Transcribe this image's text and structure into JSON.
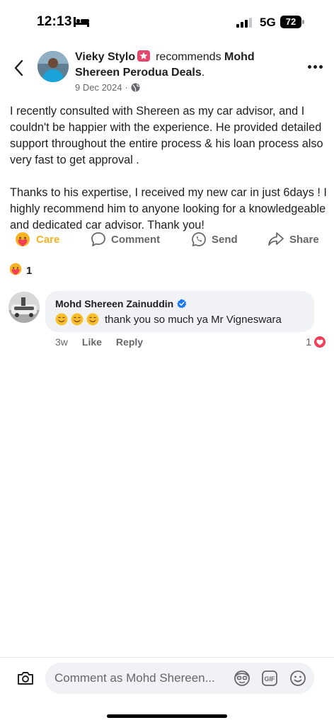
{
  "status_bar": {
    "time": "12:13",
    "network": "5G",
    "battery": "72"
  },
  "header": {
    "author_name": "Vieky Stylo",
    "recommends_label": "recommends",
    "page_name": "Mohd Shereen Perodua Deals",
    "page_suffix": ".",
    "date": "9 Dec 2024",
    "privacy": "public"
  },
  "post": {
    "paragraph_1": "I recently consulted with Shereen as my car advisor, and I couldn't be happier with the experience. He provided detailed support throughout the entire process & his loan process also very fast to get approval .",
    "paragraph_2": "Thanks to his expertise, I received my new car in just 6days ! I highly recommend him to anyone looking for a knowledgeable and dedicated car advisor. Thank you!"
  },
  "actions": {
    "care": "Care",
    "comment": "Comment",
    "send": "Send",
    "share": "Share"
  },
  "reactions": {
    "count": "1"
  },
  "comment": {
    "author": "Mohd Shereen Zainuddin",
    "text": "thank you so much ya Mr Vigneswara",
    "time": "3w",
    "like_label": "Like",
    "reply_label": "Reply",
    "like_count": "1"
  },
  "composer": {
    "placeholder": "Comment as Mohd Shereen..."
  },
  "colors": {
    "accent_care": "#f7b125",
    "verified": "#1877f2",
    "heart": "#f33e58",
    "bubble": "#f0f2f5"
  }
}
